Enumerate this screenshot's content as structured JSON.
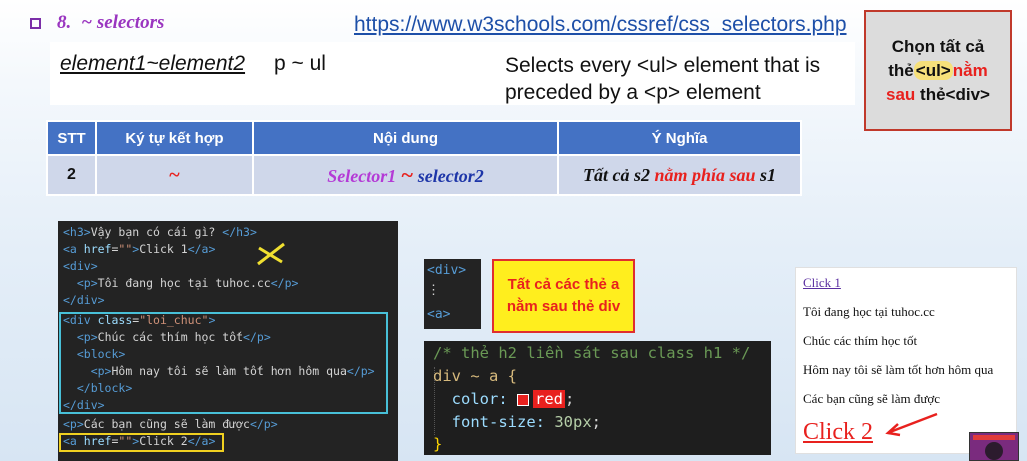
{
  "header": {
    "number": "8.",
    "title": "~ selectors",
    "url": "https://www.w3schools.com/cssref/css_selectors.php"
  },
  "definition": {
    "term": "element1~element2",
    "example": "p ~ ul",
    "description": "Selects every <ul> element that is preceded by a <p> element"
  },
  "note": {
    "line1": "Chọn tất cả",
    "line2_pre": "thẻ",
    "line2_hl": "<ul>",
    "line2_red": "nằm",
    "line3_red": "sau",
    "line3_rest": "thẻ<div>"
  },
  "table": {
    "headers": [
      "STT",
      "Ký tự kết hợp",
      "Nội dung",
      "Ý Nghĩa"
    ],
    "row": {
      "stt": "2",
      "symbol": "~",
      "content_s1": "Selector1",
      "content_tilde": "~",
      "content_s2": "selector2",
      "meaning_pre": "Tất cả s2",
      "meaning_red": "nằm phía sau",
      "meaning_post": "s1"
    }
  },
  "code_panel": {
    "lines": [
      "<h3>Vậy bạn có cái gì? </h3>",
      "<a href=\"\">Click 1</a>",
      "<div>",
      "  <p>Tôi đang học tại tuhoc.cc</p>",
      "</div>",
      "<div class=\"loi_chuc\">",
      "  <p>Chúc các thím học tốt</p>",
      "  <block>",
      "    <p>Hôm nay tôi sẽ làm tốt hơn hôm qua</p>",
      "  </block>",
      "</div>",
      "<p>Các bạn cũng sẽ làm được</p>",
      "<a href=\"\">Click 2</a>"
    ]
  },
  "small_panel": {
    "line1": "<div>",
    "line2": "⋮",
    "line3": "<a>"
  },
  "yellow_note": {
    "line1": "Tất cả các thẻ a",
    "line2": "nằm sau thẻ div"
  },
  "css_panel": {
    "comment": "/* thẻ h2 liền sát sau class h1 */",
    "selector": "div ~ a {",
    "prop1": "color:",
    "val1": "red",
    "prop2": "font-size:",
    "val2": "30px",
    "close": "}"
  },
  "preview": {
    "link1": "Click 1",
    "p1": "Tôi đang học tại tuhoc.cc",
    "p2": "Chúc các thím học tốt",
    "p3": "Hôm nay tôi sẽ làm tốt hơn hôm qua",
    "p4": "Các bạn cũng sẽ làm được",
    "link2": "Click 2"
  },
  "colors": {
    "accent_purple": "#9a35c0",
    "table_header": "#4472c4",
    "red": "#e8211e",
    "note_yellow": "#ffee1e"
  }
}
